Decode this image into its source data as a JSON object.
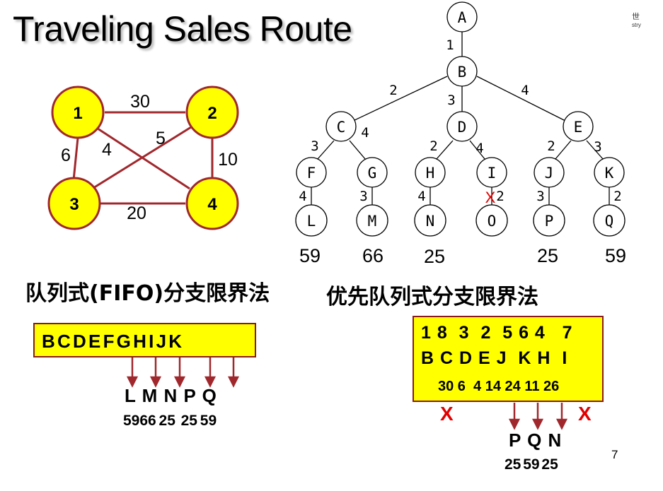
{
  "title": "Traveling Sales Route",
  "corner_mark": {
    "line1": "世",
    "line2": "stry"
  },
  "graph": {
    "nodes": [
      "1",
      "2",
      "3",
      "4"
    ],
    "edge_labels": {
      "e12": "30",
      "e13": "6",
      "e14": "4",
      "e23": "5",
      "e24": "10",
      "e34": "20"
    }
  },
  "tree": {
    "nodes": {
      "A": "A",
      "B": "B",
      "C": "C",
      "D": "D",
      "E": "E",
      "F": "F",
      "G": "G",
      "H": "H",
      "I": "I",
      "J": "J",
      "K": "K",
      "L": "L",
      "M": "M",
      "N": "N",
      "O": "O",
      "P": "P",
      "Q": "Q"
    },
    "edge_labels": {
      "AB": "1",
      "BC": "2",
      "BD": "3",
      "BE": "4",
      "CF": "3",
      "CG": "4",
      "DH": "2",
      "DI": "4",
      "EJ": "2",
      "EK": "3",
      "FL": "4",
      "GM": "3",
      "HN": "4",
      "IO": "2",
      "JP": "3",
      "KQ": "2"
    },
    "pruned_mark": "X",
    "leaf_costs": {
      "L": "59",
      "M": "66",
      "N": "25",
      "P": "25",
      "Q": "59"
    }
  },
  "fifo": {
    "heading": "队列式(FIFO)分支限界法",
    "queue": "B C D E F G H I J K",
    "results": "L M N  P Q",
    "costs": "5966 25  25 59"
  },
  "priority": {
    "heading": "优先队列式分支限界法",
    "order_row": "1 8  3  2  5 6 4   7",
    "node_row": "B C D E J  K H  I",
    "cost_row": "30 6  4 14 24 11 26",
    "x_left": "X",
    "x_right": "X",
    "results": "P Q N",
    "costs": "25 59 25"
  },
  "page_number": "7",
  "colors": {
    "node_fill": "#ffff00",
    "edge": "#a0282d",
    "queue_fill": "#ffff00",
    "x_mark": "#e00000",
    "arrow": "#a0282d"
  }
}
